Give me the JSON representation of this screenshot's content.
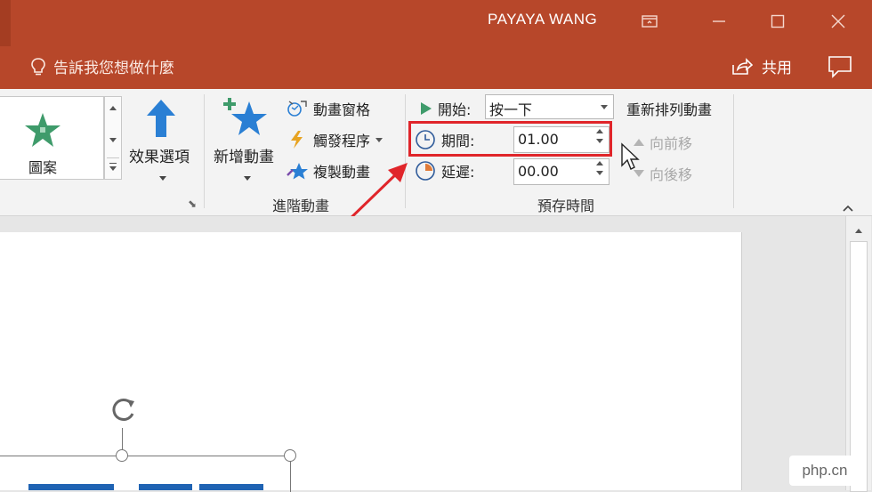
{
  "titlebar": {
    "user_name": "PAYAYA WANG"
  },
  "tellbar": {
    "tell_me": "告訴我您想做什麼",
    "share": "共用"
  },
  "ribbon": {
    "gallery_item": "圖案",
    "effect_options": "效果選項",
    "add_animation": "新增動畫",
    "animation_pane": "動畫窗格",
    "trigger": "觸發程序",
    "animation_painter": "複製動畫",
    "advanced_group": "進階動畫",
    "start_label": "開始:",
    "start_value": "按一下",
    "duration_label": "期間:",
    "duration_value": "01.00",
    "delay_label": "延遲:",
    "delay_value": "00.00",
    "timing_group": "預存時間",
    "reorder_title": "重新排列動畫",
    "move_earlier": "向前移",
    "move_later": "向後移"
  },
  "watermark": "php.cn",
  "colors": {
    "titlebar": "#b7472a",
    "highlight": "#e0252a",
    "accent_green": "#3f9b6b",
    "accent_blue": "#2a7fd4"
  }
}
